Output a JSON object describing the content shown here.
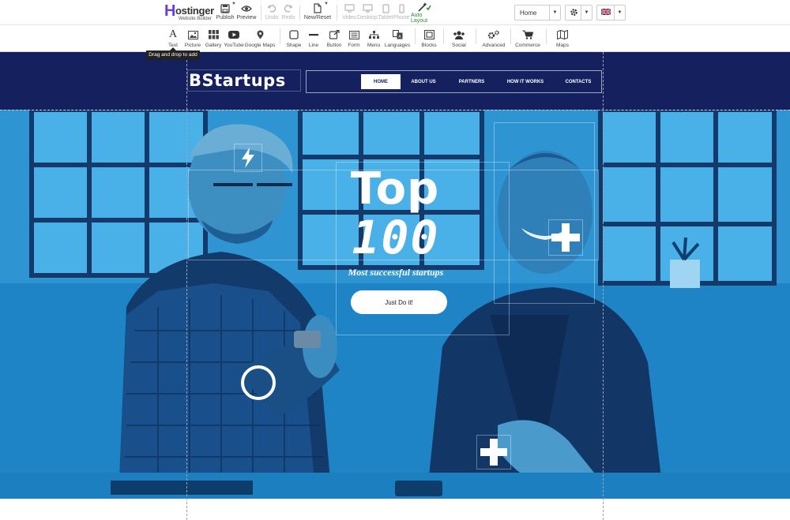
{
  "editor": {
    "logo": {
      "word": "ostinger",
      "mark": "H",
      "subtitle": "Website Builder"
    },
    "top_actions": {
      "publish": "Publish",
      "preview": "Preview",
      "undo": "Undo",
      "redo": "Redo",
      "new_reset": "New/Reset",
      "video": "Video",
      "desktop": "Desktop",
      "tablet": "Tablet",
      "phone": "Phone",
      "auto_layout": "Auto Layout",
      "auto_layout_badge": "ON"
    },
    "page_select": {
      "value": "Home"
    },
    "settings_icon": "gear-icon",
    "language_flag": "uk-flag-icon",
    "tools": [
      {
        "label": "Text",
        "icon": "text-icon"
      },
      {
        "label": "Picture",
        "icon": "picture-icon"
      },
      {
        "label": "Gallery",
        "icon": "gallery-icon"
      },
      {
        "label": "YouTube",
        "icon": "youtube-icon"
      },
      {
        "label": "Google Maps",
        "icon": "map-pin-icon"
      },
      {
        "label": "Shape",
        "icon": "shape-icon"
      },
      {
        "label": "Line",
        "icon": "line-icon"
      },
      {
        "label": "Button",
        "icon": "button-icon"
      },
      {
        "label": "Form",
        "icon": "form-icon"
      },
      {
        "label": "Menu",
        "icon": "menu-icon"
      },
      {
        "label": "Languages",
        "icon": "languages-icon"
      },
      {
        "label": "Blocks",
        "icon": "blocks-icon"
      },
      {
        "label": "Social",
        "icon": "social-icon"
      },
      {
        "label": "Advanced",
        "icon": "advanced-icon"
      },
      {
        "label": "Commerce",
        "icon": "cart-icon"
      },
      {
        "label": "Maps",
        "icon": "maps-icon"
      }
    ],
    "tooltip": "Drag and drop to add"
  },
  "site": {
    "brand": "BStartups",
    "nav": [
      "HOME",
      "ABOUT US",
      "PARTNERS",
      "HOW IT WORKS",
      "CONTACTS"
    ],
    "active_nav": "HOME",
    "hero": {
      "title": "Top",
      "number": "100",
      "subtitle": "Most successful startups",
      "cta": "Just Do it!"
    },
    "colors": {
      "header_bg": "#15215f",
      "hero_tint": "#1f86c9"
    }
  }
}
